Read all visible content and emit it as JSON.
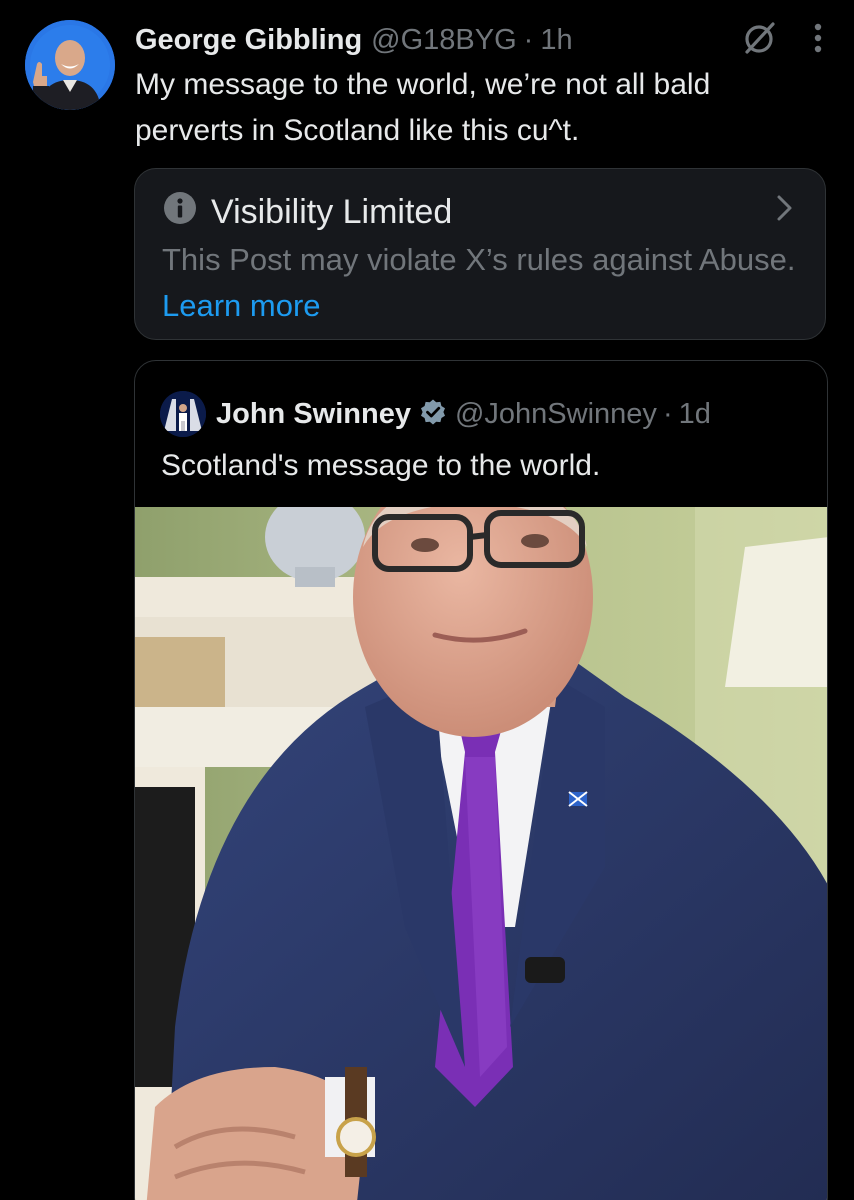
{
  "post": {
    "display_name": "George Gibbling",
    "handle": "@G18BYG",
    "separator": "·",
    "time": "1h",
    "text": "My message to the world, we’re not all bald perverts in Scotland like this cu^t.",
    "icons": {
      "grok": "grok-slash-icon",
      "more": "more-vertical-icon"
    }
  },
  "visibility": {
    "title": "Visibility Limited",
    "body": "This Post may violate X’s rules against Abuse.",
    "link": "Learn more",
    "icons": {
      "info": "info-icon",
      "chevron": "chevron-right-icon"
    }
  },
  "quote": {
    "display_name": "John Swinney",
    "handle": "@JohnSwinney",
    "separator": "·",
    "time": "1d",
    "text": "Scotland's message to the world.",
    "verified_icon": "verified-badge-icon"
  },
  "colors": {
    "background": "#000000",
    "text_primary": "#e7e9ea",
    "text_secondary": "#71767b",
    "link": "#1d9bf0",
    "border": "#2f3336",
    "card_bg": "#16181c",
    "tie": "#7a2fb5",
    "suit": "#2c3a66"
  }
}
